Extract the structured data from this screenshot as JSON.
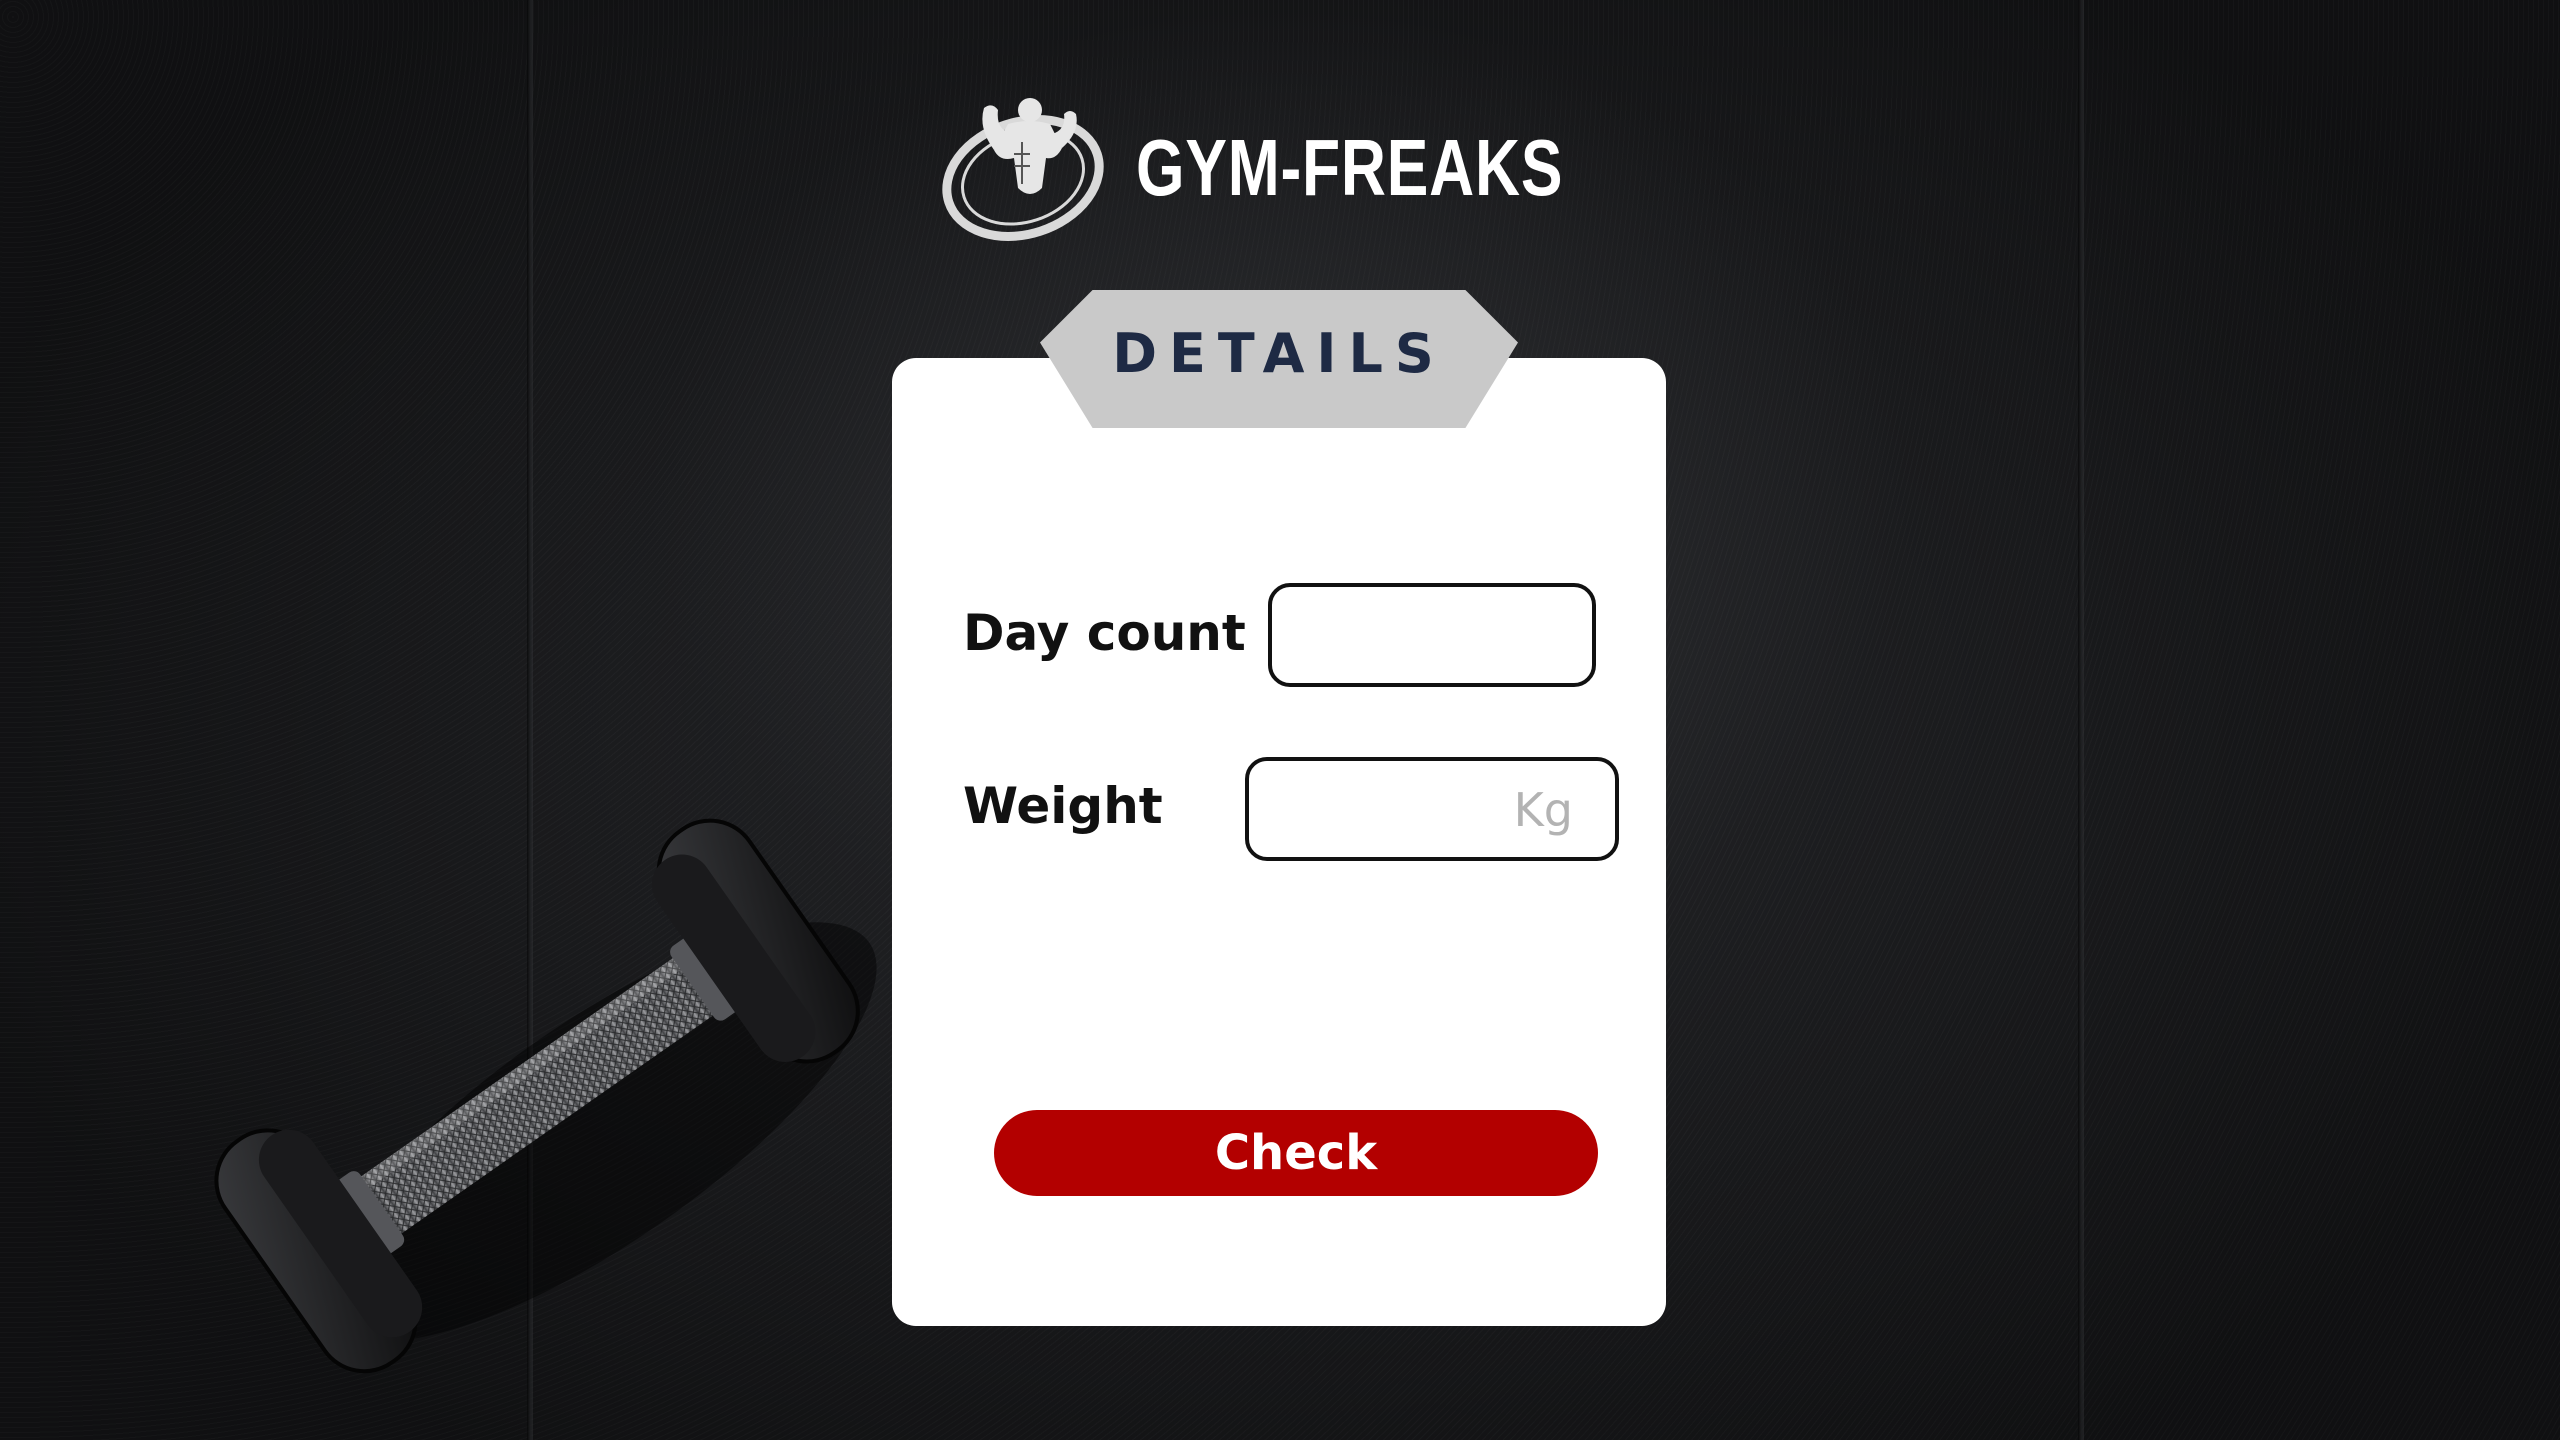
{
  "logo": {
    "text": "GYM-FREAKS",
    "emblem_icon": "bodybuilder-emblem-icon"
  },
  "card": {
    "tab_title": "DETAILS",
    "fields": [
      {
        "label": "Day count",
        "value": "",
        "unit": ""
      },
      {
        "label": "Weight",
        "value": "",
        "unit": "Kg"
      }
    ],
    "check_label": "Check"
  },
  "colors": {
    "button": "#b30000",
    "tab_background": "#c9c9c9",
    "tab_text": "#1e2a44",
    "card_background": "#ffffff",
    "background": "#232427"
  },
  "decor": {
    "background_icon": "dumbbell-icon"
  }
}
